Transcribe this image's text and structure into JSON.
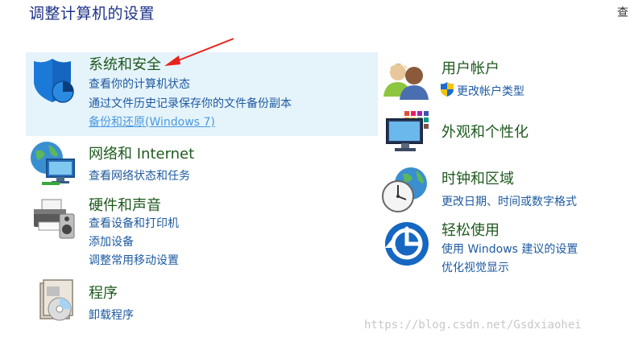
{
  "page_title": "调整计算机的设置",
  "view_by_label": "查",
  "categories": {
    "system_security": {
      "title": "系统和安全",
      "links": [
        "查看你的计算机状态",
        "通过文件历史记录保存你的文件备份副本",
        "备份和还原(Windows 7)"
      ]
    },
    "network": {
      "title": "网络和 Internet",
      "links": [
        "查看网络状态和任务"
      ]
    },
    "hardware": {
      "title": "硬件和声音",
      "links": [
        "查看设备和打印机",
        "添加设备",
        "调整常用移动设置"
      ]
    },
    "programs": {
      "title": "程序",
      "links": [
        "卸载程序"
      ]
    },
    "user_accounts": {
      "title": "用户帐户",
      "links": [
        "更改帐户类型"
      ]
    },
    "appearance": {
      "title": "外观和个性化",
      "links": []
    },
    "clock_region": {
      "title": "时钟和区域",
      "links": [
        "更改日期、时间或数字格式"
      ]
    },
    "ease_of_access": {
      "title": "轻松使用",
      "links": [
        "使用 Windows 建议的设置",
        "优化视觉显示"
      ]
    }
  },
  "watermark": "https://blog.csdn.net/Gsdxiaohei",
  "colors": {
    "highlight_bg": "#e5f3fb",
    "category_title": "#1e5a1e",
    "link": "#1e5aa0",
    "link_hover": "#4a9be0",
    "annotation_arrow": "#e8231c"
  }
}
